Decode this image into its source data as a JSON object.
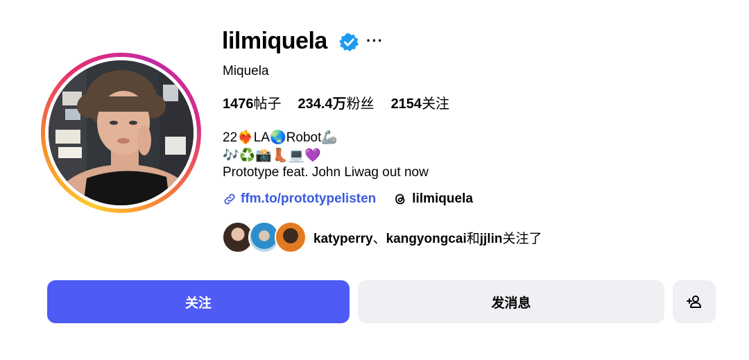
{
  "profile": {
    "username": "lilmiquela",
    "more_label": "···",
    "full_name": "Miquela",
    "verified_icon": "verified-badge-icon",
    "colors": {
      "accent": "#4f5bf5",
      "link": "#3b5bdb",
      "verified": "#1d9bf0",
      "secondary_bg": "#eff0f3"
    }
  },
  "stats": {
    "posts_count": "1476",
    "posts_label": "帖子",
    "followers_count": "234.4万",
    "followers_label": "粉丝",
    "following_count": "2154",
    "following_label": "关注"
  },
  "bio": {
    "line1": "22❤️‍🔥LA🌏Robot🦾",
    "line2": "🎶♻️📸👢💻💜",
    "line3": "Prototype feat. John Liwag out now"
  },
  "links": {
    "external_icon": "link-icon",
    "external_text": "ffm.to/prototypelisten",
    "threads_icon": "threads-icon",
    "threads_text": "lilmiquela"
  },
  "followed_by": {
    "user1": "katyperry",
    "separator": "、",
    "user2": "kangyongcai",
    "conjunction": "和",
    "user3": "jjlin",
    "suffix": "关注了"
  },
  "actions": {
    "follow_label": "关注",
    "message_label": "发消息",
    "add_person_icon": "add-person-icon"
  }
}
